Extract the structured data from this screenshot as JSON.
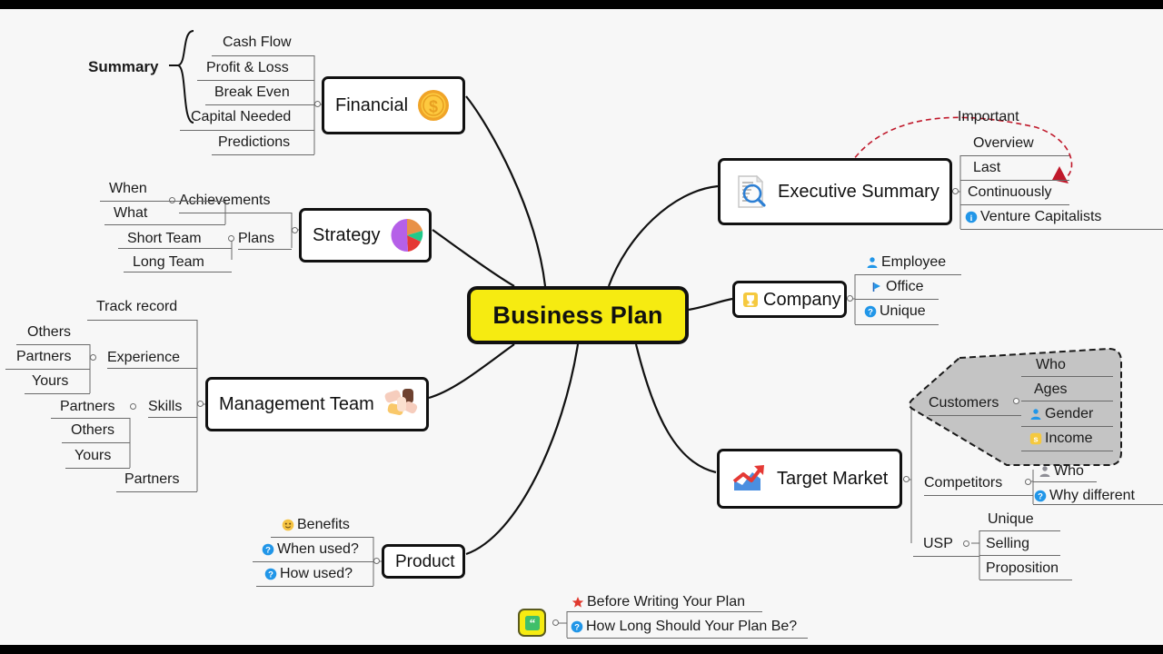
{
  "title": "Business Plan Mind Map",
  "central": {
    "label": "Business Plan",
    "color": "#f6eb11"
  },
  "branches": {
    "financial": {
      "label": "Financial",
      "icon": "gold-coin-dollar-icon",
      "children": [
        "Cash Flow",
        "Profit & Loss",
        "Break Even",
        "Capital Needed",
        "Predictions"
      ],
      "group_label": "Summary"
    },
    "strategy": {
      "label": "Strategy",
      "icon": "pie-chart-icon",
      "children": [
        {
          "label": "Achievements",
          "children": [
            "When",
            "What"
          ]
        },
        {
          "label": "Plans",
          "children": [
            "Short Team",
            "Long Team"
          ]
        }
      ]
    },
    "management_team": {
      "label": "Management Team",
      "icon": "handshake-teamwork-icon",
      "children": [
        {
          "label": "Track record"
        },
        {
          "label": "Experience",
          "children": [
            "Others",
            "Partners",
            "Yours"
          ]
        },
        {
          "label": "Skills",
          "children": [
            "Partners",
            "Others",
            "Yours"
          ]
        },
        {
          "label": "Partners"
        }
      ]
    },
    "product": {
      "label": "Product",
      "children": [
        {
          "label": "Benefits",
          "icon": "smiley-face-icon"
        },
        {
          "label": "When used?",
          "icon": "question-mark-icon"
        },
        {
          "label": "How used?",
          "icon": "question-mark-icon"
        }
      ]
    },
    "executive_summary": {
      "label": "Executive Summary",
      "icon": "document-search-icon",
      "children": [
        {
          "label": "Overview"
        },
        {
          "label": "Last"
        },
        {
          "label": "Continuously"
        },
        {
          "label": "Venture Capitalists",
          "icon": "info-icon"
        }
      ]
    },
    "company": {
      "label": "Company",
      "icon": "trophy-icon",
      "children": [
        {
          "label": "Employee",
          "icon": "person-icon"
        },
        {
          "label": "Office",
          "icon": "flag-icon"
        },
        {
          "label": "Unique",
          "icon": "question-mark-icon"
        }
      ]
    },
    "target_market": {
      "label": "Target Market",
      "icon": "growth-chart-icon",
      "children": [
        {
          "label": "Customers",
          "grouped": true,
          "children": [
            {
              "label": "Who"
            },
            {
              "label": "Ages"
            },
            {
              "label": "Gender",
              "icon": "person-icon"
            },
            {
              "label": "Income",
              "icon": "money-icon"
            }
          ]
        },
        {
          "label": "Competitors",
          "children": [
            {
              "label": "Who",
              "icon": "person-gray-icon"
            },
            {
              "label": "Why different",
              "icon": "question-mark-icon"
            }
          ]
        },
        {
          "label": "USP",
          "children": [
            "Unique",
            "Selling",
            "Proposition"
          ]
        }
      ]
    },
    "notes": {
      "icon": "quote-icon",
      "children": [
        {
          "label": "Before Writing Your Plan",
          "icon": "star-icon"
        },
        {
          "label": "How Long Should Your Plan Be?",
          "icon": "question-mark-icon"
        }
      ]
    }
  },
  "relationship": {
    "label": "Important",
    "style": "dashed-arrow",
    "color": "#c0192b",
    "from": "Executive Summary",
    "to": "Venture Capitalists"
  },
  "colors": {
    "central_fill": "#f6eb11",
    "group_fill": "#c4c4c4",
    "line": "#111111",
    "accent_blue": "#2196e8",
    "accent_red": "#c0192b"
  }
}
